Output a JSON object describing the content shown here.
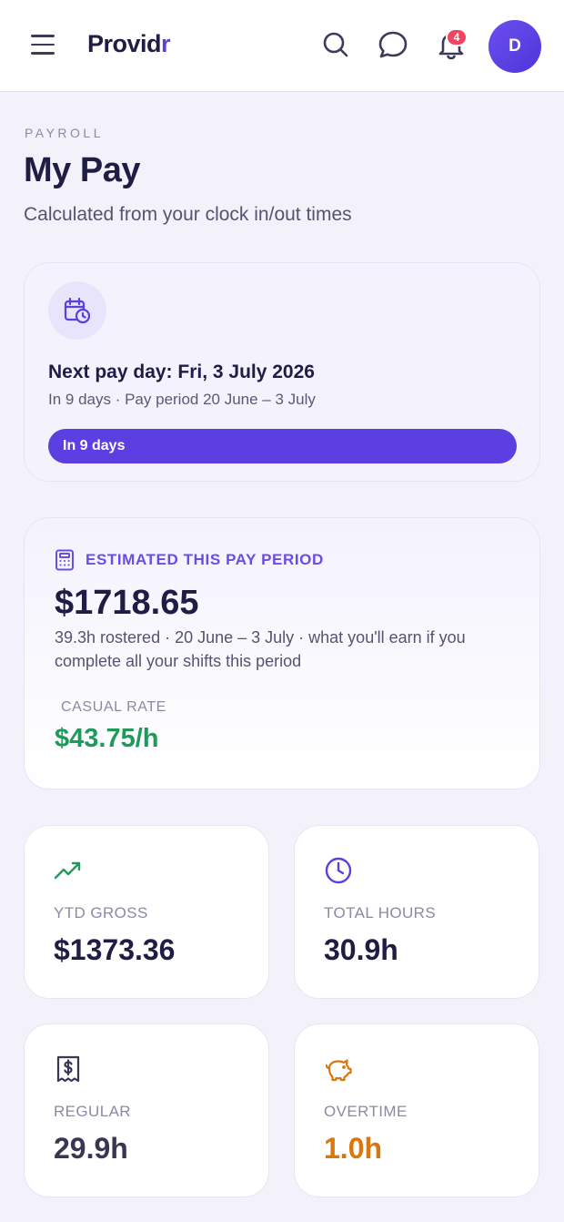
{
  "app": {
    "brand_main": "Provid",
    "brand_accent": "r",
    "notification_count": "4",
    "avatar_initial": "D"
  },
  "header": {
    "icons": [
      "menu-icon",
      "search-icon",
      "chat-icon",
      "bell-icon"
    ]
  },
  "page": {
    "eyebrow": "PAYROLL",
    "title": "My Pay",
    "subtitle": "Calculated from your clock in/out times"
  },
  "payday": {
    "icon": "calendar-clock-icon",
    "title": "Next pay day: Fri, 3 July 2026",
    "subtitle": "In 9 days · Pay period 20 June – 3 July",
    "pill_label": "In 9 days"
  },
  "estimate": {
    "icon": "calculator-icon",
    "label": "ESTIMATED THIS PAY PERIOD",
    "amount": "$1718.65",
    "description": "39.3h rostered · 20 June – 3 July · what you'll earn if you complete all your shifts this period",
    "rate_label": "CASUAL RATE",
    "rate_value": "$43.75/h"
  },
  "stats": {
    "ytd": {
      "icon": "trending-up-icon",
      "label": "YTD GROSS",
      "value": "$1373.36"
    },
    "hours": {
      "icon": "clock-icon",
      "label": "TOTAL HOURS",
      "value": "30.9h"
    },
    "regular": {
      "icon": "receipt-icon",
      "label": "REGULAR",
      "value": "29.9h"
    },
    "overtime": {
      "icon": "piggy-bank-icon",
      "label": "OVERTIME",
      "value": "1.0h"
    }
  },
  "colors": {
    "brand": "#5b3fe0",
    "text_dark": "#1f1d44",
    "rate_green": "#1f9a5c",
    "overtime_orange": "#d9760e",
    "regular_text": "#3b3554",
    "badge_red": "#ef4560",
    "background": "#f3f2fa"
  }
}
